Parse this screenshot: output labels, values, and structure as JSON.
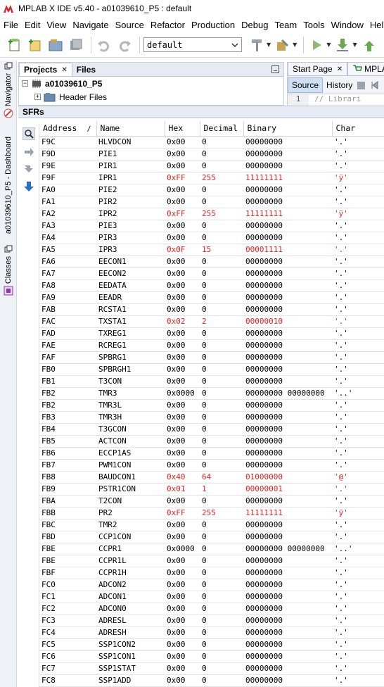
{
  "window": {
    "title": "MPLAB X IDE v5.40 - a01039610_P5 : default"
  },
  "menu": [
    "File",
    "Edit",
    "View",
    "Navigate",
    "Source",
    "Refactor",
    "Production",
    "Debug",
    "Team",
    "Tools",
    "Window",
    "Help"
  ],
  "toolbar": {
    "config_value": "default"
  },
  "side_tabs": {
    "navigator": "Navigator",
    "dashboard": "a01039610_P5 - Dashboard",
    "classes": "Classes"
  },
  "projects": {
    "tab_projects": "Projects",
    "tab_files": "Files",
    "project_name": "a01039610_P5",
    "header_files": "Header Files"
  },
  "editor": {
    "tab_start": "Start Page",
    "tab_mpla": "MPLA",
    "source_btn": "Source",
    "history_btn": "History",
    "line_no": "1",
    "code_text": "// Librari"
  },
  "sfr": {
    "title": "SFRs",
    "columns": [
      "Address",
      "Name",
      "Hex",
      "Decimal",
      "Binary",
      "Char"
    ],
    "sort_indicator": "/",
    "rows": [
      {
        "address": "F9C",
        "name": "HLVDCON",
        "hex": "0x00",
        "decimal": "0",
        "binary": "00000000",
        "char": "'.'",
        "changed": false
      },
      {
        "address": "F9D",
        "name": "PIE1",
        "hex": "0x00",
        "decimal": "0",
        "binary": "00000000",
        "char": "'.'",
        "changed": false
      },
      {
        "address": "F9E",
        "name": "PIR1",
        "hex": "0x00",
        "decimal": "0",
        "binary": "00000000",
        "char": "'.'",
        "changed": false
      },
      {
        "address": "F9F",
        "name": "IPR1",
        "hex": "0xFF",
        "decimal": "255",
        "binary": "11111111",
        "char": "'ÿ'",
        "changed": true
      },
      {
        "address": "FA0",
        "name": "PIE2",
        "hex": "0x00",
        "decimal": "0",
        "binary": "00000000",
        "char": "'.'",
        "changed": false
      },
      {
        "address": "FA1",
        "name": "PIR2",
        "hex": "0x00",
        "decimal": "0",
        "binary": "00000000",
        "char": "'.'",
        "changed": false
      },
      {
        "address": "FA2",
        "name": "IPR2",
        "hex": "0xFF",
        "decimal": "255",
        "binary": "11111111",
        "char": "'ÿ'",
        "changed": true
      },
      {
        "address": "FA3",
        "name": "PIE3",
        "hex": "0x00",
        "decimal": "0",
        "binary": "00000000",
        "char": "'.'",
        "changed": false
      },
      {
        "address": "FA4",
        "name": "PIR3",
        "hex": "0x00",
        "decimal": "0",
        "binary": "00000000",
        "char": "'.'",
        "changed": false
      },
      {
        "address": "FA5",
        "name": "IPR3",
        "hex": "0x0F",
        "decimal": "15",
        "binary": "00001111",
        "char": "'.'",
        "changed": true
      },
      {
        "address": "FA6",
        "name": "EECON1",
        "hex": "0x00",
        "decimal": "0",
        "binary": "00000000",
        "char": "'.'",
        "changed": false
      },
      {
        "address": "FA7",
        "name": "EECON2",
        "hex": "0x00",
        "decimal": "0",
        "binary": "00000000",
        "char": "'.'",
        "changed": false
      },
      {
        "address": "FA8",
        "name": "EEDATA",
        "hex": "0x00",
        "decimal": "0",
        "binary": "00000000",
        "char": "'.'",
        "changed": false
      },
      {
        "address": "FA9",
        "name": "EEADR",
        "hex": "0x00",
        "decimal": "0",
        "binary": "00000000",
        "char": "'.'",
        "changed": false
      },
      {
        "address": "FAB",
        "name": "RCSTA1",
        "hex": "0x00",
        "decimal": "0",
        "binary": "00000000",
        "char": "'.'",
        "changed": false
      },
      {
        "address": "FAC",
        "name": "TXSTA1",
        "hex": "0x02",
        "decimal": "2",
        "binary": "00000010",
        "char": "'.'",
        "changed": true
      },
      {
        "address": "FAD",
        "name": "TXREG1",
        "hex": "0x00",
        "decimal": "0",
        "binary": "00000000",
        "char": "'.'",
        "changed": false
      },
      {
        "address": "FAE",
        "name": "RCREG1",
        "hex": "0x00",
        "decimal": "0",
        "binary": "00000000",
        "char": "'.'",
        "changed": false
      },
      {
        "address": "FAF",
        "name": "SPBRG1",
        "hex": "0x00",
        "decimal": "0",
        "binary": "00000000",
        "char": "'.'",
        "changed": false
      },
      {
        "address": "FB0",
        "name": "SPBRGH1",
        "hex": "0x00",
        "decimal": "0",
        "binary": "00000000",
        "char": "'.'",
        "changed": false
      },
      {
        "address": "FB1",
        "name": "T3CON",
        "hex": "0x00",
        "decimal": "0",
        "binary": "00000000",
        "char": "'.'",
        "changed": false
      },
      {
        "address": "FB2",
        "name": "TMR3",
        "hex": "0x0000",
        "decimal": "0",
        "binary": "00000000 00000000",
        "char": "'..'",
        "changed": false
      },
      {
        "address": "FB2",
        "name": "TMR3L",
        "hex": "0x00",
        "decimal": "0",
        "binary": "00000000",
        "char": "'.'",
        "changed": false
      },
      {
        "address": "FB3",
        "name": "TMR3H",
        "hex": "0x00",
        "decimal": "0",
        "binary": "00000000",
        "char": "'.'",
        "changed": false
      },
      {
        "address": "FB4",
        "name": "T3GCON",
        "hex": "0x00",
        "decimal": "0",
        "binary": "00000000",
        "char": "'.'",
        "changed": false
      },
      {
        "address": "FB5",
        "name": "ACTCON",
        "hex": "0x00",
        "decimal": "0",
        "binary": "00000000",
        "char": "'.'",
        "changed": false
      },
      {
        "address": "FB6",
        "name": "ECCP1AS",
        "hex": "0x00",
        "decimal": "0",
        "binary": "00000000",
        "char": "'.'",
        "changed": false
      },
      {
        "address": "FB7",
        "name": "PWM1CON",
        "hex": "0x00",
        "decimal": "0",
        "binary": "00000000",
        "char": "'.'",
        "changed": false
      },
      {
        "address": "FB8",
        "name": "BAUDCON1",
        "hex": "0x40",
        "decimal": "64",
        "binary": "01000000",
        "char": "'@'",
        "changed": true
      },
      {
        "address": "FB9",
        "name": "PSTR1CON",
        "hex": "0x01",
        "decimal": "1",
        "binary": "00000001",
        "char": "'.'",
        "changed": true
      },
      {
        "address": "FBA",
        "name": "T2CON",
        "hex": "0x00",
        "decimal": "0",
        "binary": "00000000",
        "char": "'.'",
        "changed": false
      },
      {
        "address": "FBB",
        "name": "PR2",
        "hex": "0xFF",
        "decimal": "255",
        "binary": "11111111",
        "char": "'ÿ'",
        "changed": true
      },
      {
        "address": "FBC",
        "name": "TMR2",
        "hex": "0x00",
        "decimal": "0",
        "binary": "00000000",
        "char": "'.'",
        "changed": false
      },
      {
        "address": "FBD",
        "name": "CCP1CON",
        "hex": "0x00",
        "decimal": "0",
        "binary": "00000000",
        "char": "'.'",
        "changed": false
      },
      {
        "address": "FBE",
        "name": "CCPR1",
        "hex": "0x0000",
        "decimal": "0",
        "binary": "00000000 00000000",
        "char": "'..'",
        "changed": false
      },
      {
        "address": "FBE",
        "name": "CCPR1L",
        "hex": "0x00",
        "decimal": "0",
        "binary": "00000000",
        "char": "'.'",
        "changed": false
      },
      {
        "address": "FBF",
        "name": "CCPR1H",
        "hex": "0x00",
        "decimal": "0",
        "binary": "00000000",
        "char": "'.'",
        "changed": false
      },
      {
        "address": "FC0",
        "name": "ADCON2",
        "hex": "0x00",
        "decimal": "0",
        "binary": "00000000",
        "char": "'.'",
        "changed": false
      },
      {
        "address": "FC1",
        "name": "ADCON1",
        "hex": "0x00",
        "decimal": "0",
        "binary": "00000000",
        "char": "'.'",
        "changed": false
      },
      {
        "address": "FC2",
        "name": "ADCON0",
        "hex": "0x00",
        "decimal": "0",
        "binary": "00000000",
        "char": "'.'",
        "changed": false
      },
      {
        "address": "FC3",
        "name": "ADRESL",
        "hex": "0x00",
        "decimal": "0",
        "binary": "00000000",
        "char": "'.'",
        "changed": false
      },
      {
        "address": "FC4",
        "name": "ADRESH",
        "hex": "0x00",
        "decimal": "0",
        "binary": "00000000",
        "char": "'.'",
        "changed": false
      },
      {
        "address": "FC5",
        "name": "SSP1CON2",
        "hex": "0x00",
        "decimal": "0",
        "binary": "00000000",
        "char": "'.'",
        "changed": false
      },
      {
        "address": "FC6",
        "name": "SSP1CON1",
        "hex": "0x00",
        "decimal": "0",
        "binary": "00000000",
        "char": "'.'",
        "changed": false
      },
      {
        "address": "FC7",
        "name": "SSP1STAT",
        "hex": "0x00",
        "decimal": "0",
        "binary": "00000000",
        "char": "'.'",
        "changed": false
      },
      {
        "address": "FC8",
        "name": "SSP1ADD",
        "hex": "0x00",
        "decimal": "0",
        "binary": "00000000",
        "char": "'.'",
        "changed": false
      }
    ]
  },
  "colors": {
    "changed_value": "#e8211e",
    "panel_header": "#e6ebf3",
    "accent_blue": "#2a6fc9"
  }
}
